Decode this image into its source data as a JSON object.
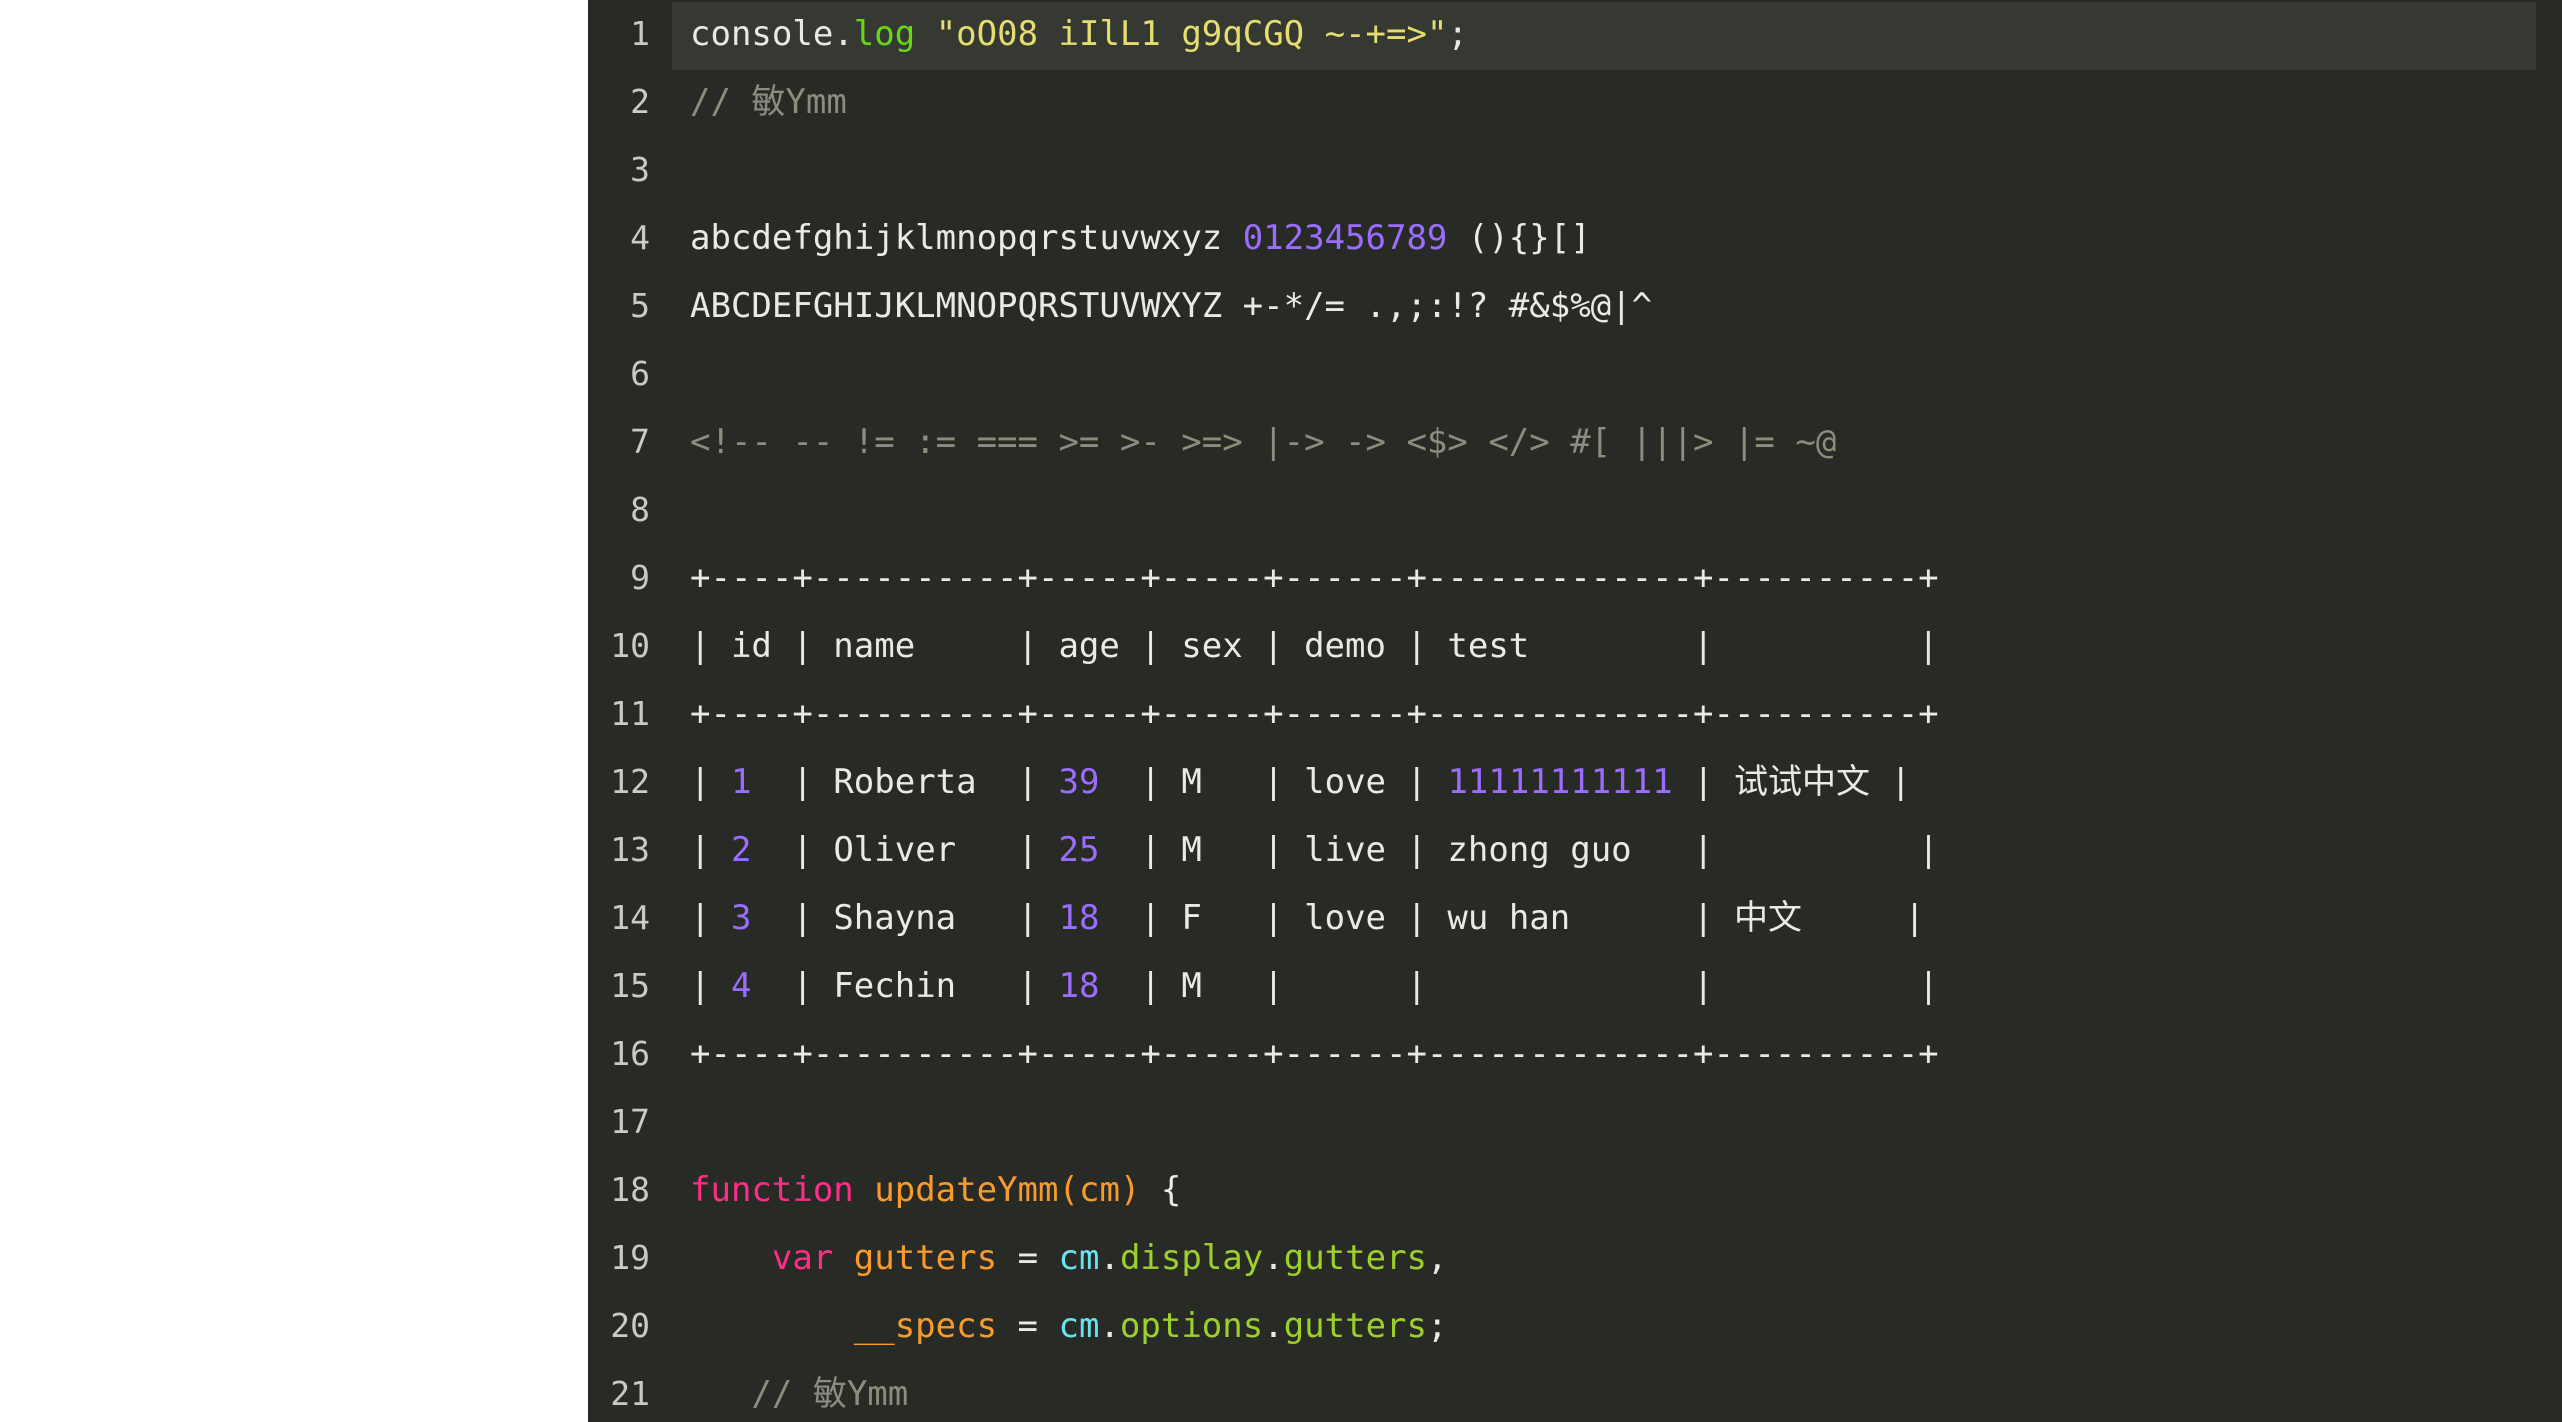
{
  "editor": {
    "background_color": "#282a26",
    "active_line_color": "#363832",
    "gutter_color": "#c8cbc2",
    "default_text_color": "#e8eae3",
    "page_background": "#ffffff",
    "colors": {
      "keyword": "#ff2d87",
      "function": "#f79b2e",
      "variable": "#f79b2e",
      "property": "#9ed02c",
      "atom": "#6ae3f0",
      "string": "#e6dd71",
      "number": "#9b6dff",
      "comment": "#8c8d7c",
      "method_green": "#67d818"
    },
    "active_line_number": 1,
    "lines": [
      {
        "number": "1",
        "active": true,
        "tokens": [
          {
            "cls": "t-def",
            "text": "console"
          },
          {
            "cls": "t-punct",
            "text": "."
          },
          {
            "cls": "t-green",
            "text": "log"
          },
          {
            "cls": "t-def",
            "text": " "
          },
          {
            "cls": "t-string",
            "text": "\"oO08 iIlL1 g9qCGQ ~-+=>\""
          },
          {
            "cls": "t-punct",
            "text": ";"
          }
        ]
      },
      {
        "number": "2",
        "active": false,
        "tokens": [
          {
            "cls": "t-comment",
            "text": "// "
          },
          {
            "cls": "t-cjk-comment",
            "text": "敏"
          },
          {
            "cls": "t-comment",
            "text": "Ymm"
          }
        ]
      },
      {
        "number": "3",
        "active": false,
        "tokens": []
      },
      {
        "number": "4",
        "active": false,
        "tokens": [
          {
            "cls": "t-def",
            "text": "abcdefghijklmnopqrstuvwxyz "
          },
          {
            "cls": "t-number",
            "text": "0123456789"
          },
          {
            "cls": "t-def",
            "text": " (){}[]"
          }
        ]
      },
      {
        "number": "5",
        "active": false,
        "tokens": [
          {
            "cls": "t-def",
            "text": "ABCDEFGHIJKLMNOPQRSTUVWXYZ +-*/= .,;:!? #&$%@|^"
          }
        ]
      },
      {
        "number": "6",
        "active": false,
        "tokens": []
      },
      {
        "number": "7",
        "active": false,
        "tokens": [
          {
            "cls": "t-ligature",
            "text": "<!-- -- != := === >= >- >=> |-> -> <$> </> #[ |||> |= ~@"
          }
        ]
      },
      {
        "number": "8",
        "active": false,
        "tokens": []
      },
      {
        "number": "9",
        "active": false,
        "tokens": [
          {
            "cls": "t-def",
            "text": "+----+----------+-----+-----+------+-------------+----------+"
          }
        ]
      },
      {
        "number": "10",
        "active": false,
        "tokens": [
          {
            "cls": "t-def",
            "text": "| id | name     | age | sex | demo | test        |          |"
          }
        ]
      },
      {
        "number": "11",
        "active": false,
        "tokens": [
          {
            "cls": "t-def",
            "text": "+----+----------+-----+-----+------+-------------+----------+"
          }
        ]
      },
      {
        "number": "12",
        "active": false,
        "tokens": [
          {
            "cls": "t-def",
            "text": "| "
          },
          {
            "cls": "t-number",
            "text": "1"
          },
          {
            "cls": "t-def",
            "text": "  | Roberta  | "
          },
          {
            "cls": "t-number",
            "text": "39"
          },
          {
            "cls": "t-def",
            "text": "  | M   | love | "
          },
          {
            "cls": "t-number",
            "text": "11111111111"
          },
          {
            "cls": "t-def",
            "text": " | "
          },
          {
            "cls": "t-cjk",
            "text": "试试中文"
          },
          {
            "cls": "t-def",
            "text": " |"
          }
        ]
      },
      {
        "number": "13",
        "active": false,
        "tokens": [
          {
            "cls": "t-def",
            "text": "| "
          },
          {
            "cls": "t-number",
            "text": "2"
          },
          {
            "cls": "t-def",
            "text": "  | Oliver   | "
          },
          {
            "cls": "t-number",
            "text": "25"
          },
          {
            "cls": "t-def",
            "text": "  | M   | live | zhong guo   |          |"
          }
        ]
      },
      {
        "number": "14",
        "active": false,
        "tokens": [
          {
            "cls": "t-def",
            "text": "| "
          },
          {
            "cls": "t-number",
            "text": "3"
          },
          {
            "cls": "t-def",
            "text": "  | Shayna   | "
          },
          {
            "cls": "t-number",
            "text": "18"
          },
          {
            "cls": "t-def",
            "text": "  | F   | love | wu han      | "
          },
          {
            "cls": "t-cjk",
            "text": "中文"
          },
          {
            "cls": "t-def",
            "text": "     |"
          }
        ]
      },
      {
        "number": "15",
        "active": false,
        "tokens": [
          {
            "cls": "t-def",
            "text": "| "
          },
          {
            "cls": "t-number",
            "text": "4"
          },
          {
            "cls": "t-def",
            "text": "  | Fechin   | "
          },
          {
            "cls": "t-number",
            "text": "18"
          },
          {
            "cls": "t-def",
            "text": "  | M   |      |             |          |"
          }
        ]
      },
      {
        "number": "16",
        "active": false,
        "tokens": [
          {
            "cls": "t-def",
            "text": "+----+----------+-----+-----+------+-------------+----------+"
          }
        ]
      },
      {
        "number": "17",
        "active": false,
        "tokens": []
      },
      {
        "number": "18",
        "active": false,
        "tokens": [
          {
            "cls": "t-keyword",
            "text": "function"
          },
          {
            "cls": "t-def",
            "text": " "
          },
          {
            "cls": "t-func",
            "text": "updateYmm"
          },
          {
            "cls": "t-func",
            "text": "("
          },
          {
            "cls": "t-func",
            "text": "cm"
          },
          {
            "cls": "t-func",
            "text": ")"
          },
          {
            "cls": "t-def",
            "text": " {"
          }
        ]
      },
      {
        "number": "19",
        "active": false,
        "tokens": [
          {
            "cls": "t-def",
            "text": "    "
          },
          {
            "cls": "t-keyword",
            "text": "var"
          },
          {
            "cls": "t-def",
            "text": " "
          },
          {
            "cls": "t-var",
            "text": "gutters"
          },
          {
            "cls": "t-def",
            "text": " = "
          },
          {
            "cls": "t-atom",
            "text": "cm"
          },
          {
            "cls": "t-punct",
            "text": "."
          },
          {
            "cls": "t-prop",
            "text": "display"
          },
          {
            "cls": "t-punct",
            "text": "."
          },
          {
            "cls": "t-prop",
            "text": "gutters"
          },
          {
            "cls": "t-def",
            "text": ","
          }
        ]
      },
      {
        "number": "20",
        "active": false,
        "tokens": [
          {
            "cls": "t-def",
            "text": "        "
          },
          {
            "cls": "t-var",
            "text": "__specs"
          },
          {
            "cls": "t-def",
            "text": " = "
          },
          {
            "cls": "t-atom",
            "text": "cm"
          },
          {
            "cls": "t-punct",
            "text": "."
          },
          {
            "cls": "t-prop",
            "text": "options"
          },
          {
            "cls": "t-punct",
            "text": "."
          },
          {
            "cls": "t-prop",
            "text": "gutters"
          },
          {
            "cls": "t-def",
            "text": ";"
          }
        ]
      },
      {
        "number": "21",
        "active": false,
        "tokens": [
          {
            "cls": "t-comment",
            "text": "   // "
          },
          {
            "cls": "t-cjk-comment",
            "text": "敏"
          },
          {
            "cls": "t-comment",
            "text": "Ymm"
          }
        ]
      }
    ]
  }
}
